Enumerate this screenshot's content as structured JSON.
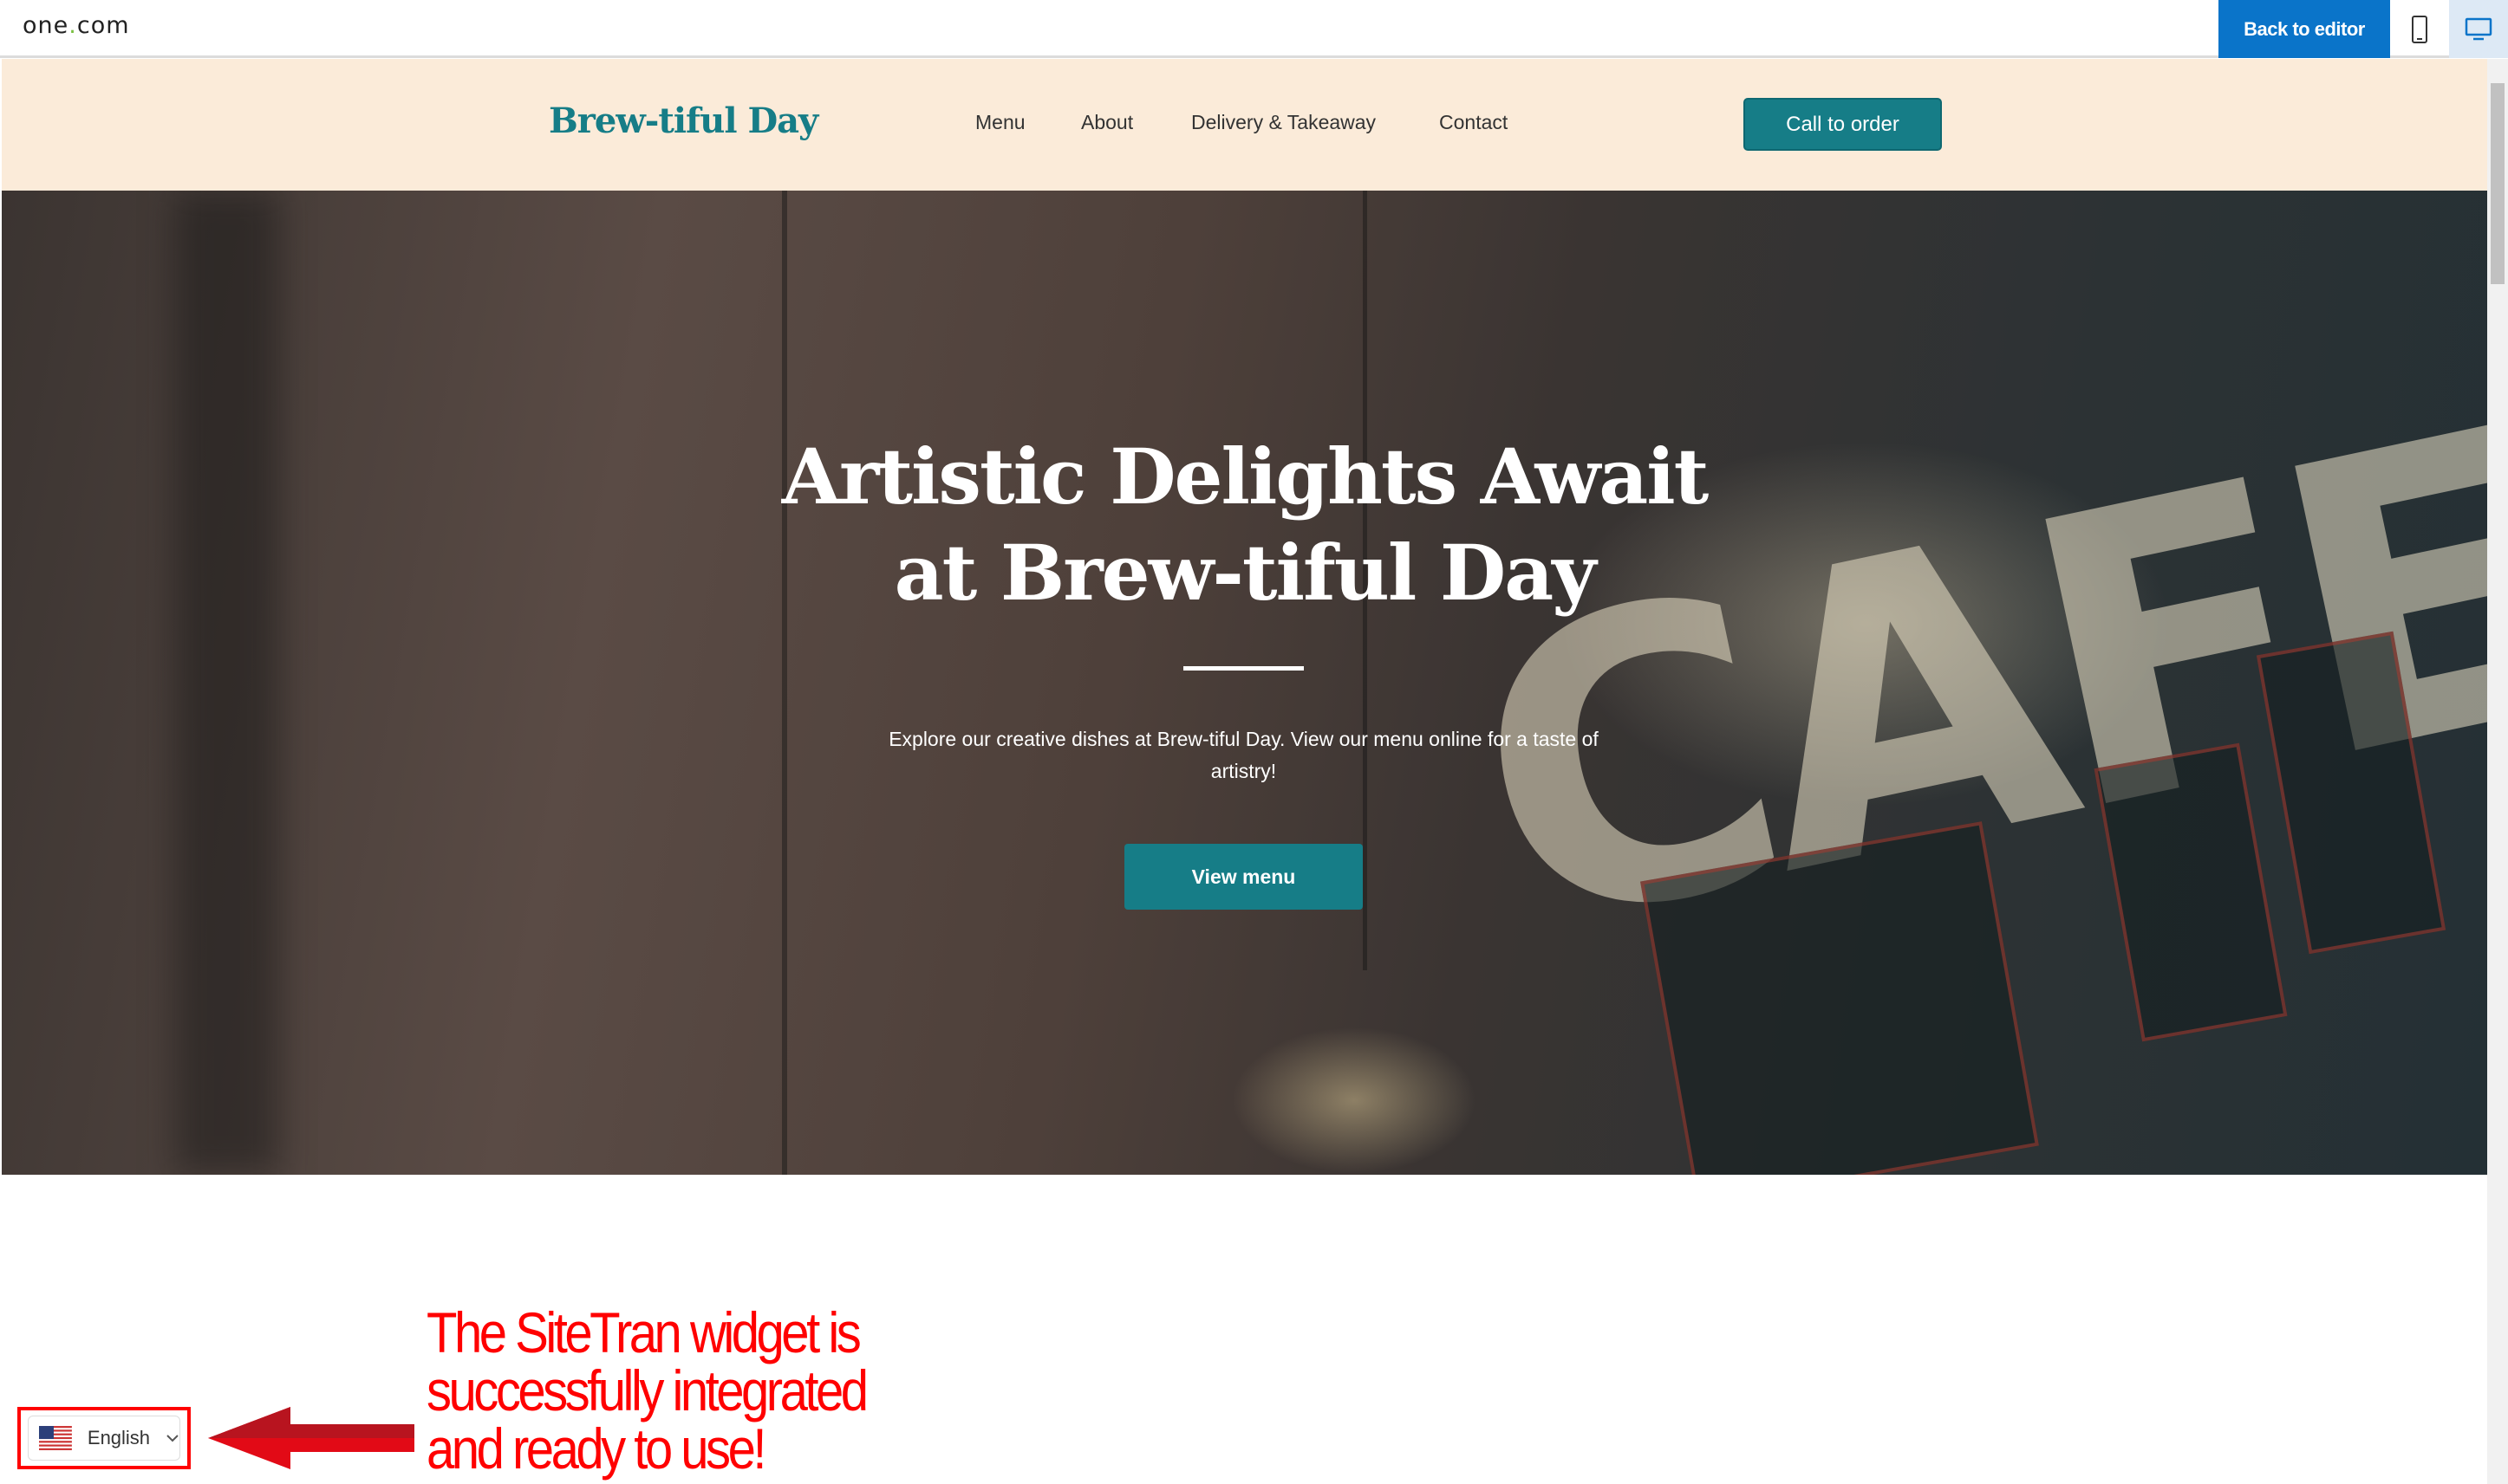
{
  "topbar": {
    "brand_name": "one",
    "brand_dot": ".",
    "brand_tld": "com",
    "back_label": "Back to editor",
    "devices": [
      {
        "icon": "mobile-icon"
      },
      {
        "icon": "desktop-icon",
        "active": true
      }
    ]
  },
  "header": {
    "logo": "Brew-tiful Day",
    "nav": [
      {
        "label": "Menu"
      },
      {
        "label": "About"
      },
      {
        "label": "Delivery & Takeaway"
      },
      {
        "label": "Contact"
      }
    ],
    "cta": "Call to order"
  },
  "hero": {
    "title_line1": "Artistic Delights Await",
    "title_line2": "at Brew-tiful Day",
    "text": "Explore our creative dishes at Brew-tiful Day. View our menu online for a taste of artistry!",
    "button": "View menu"
  },
  "widget": {
    "language": "English",
    "flag": "us-flag-icon"
  },
  "annotation": {
    "line1": "The SiteTran widget is",
    "line2": "successfully integrated",
    "line3": "and ready to use!",
    "color": "#ff0000"
  },
  "colors": {
    "accent": "#167d87",
    "header_bg": "#fbebd9",
    "editor_blue": "#0a74c9"
  }
}
